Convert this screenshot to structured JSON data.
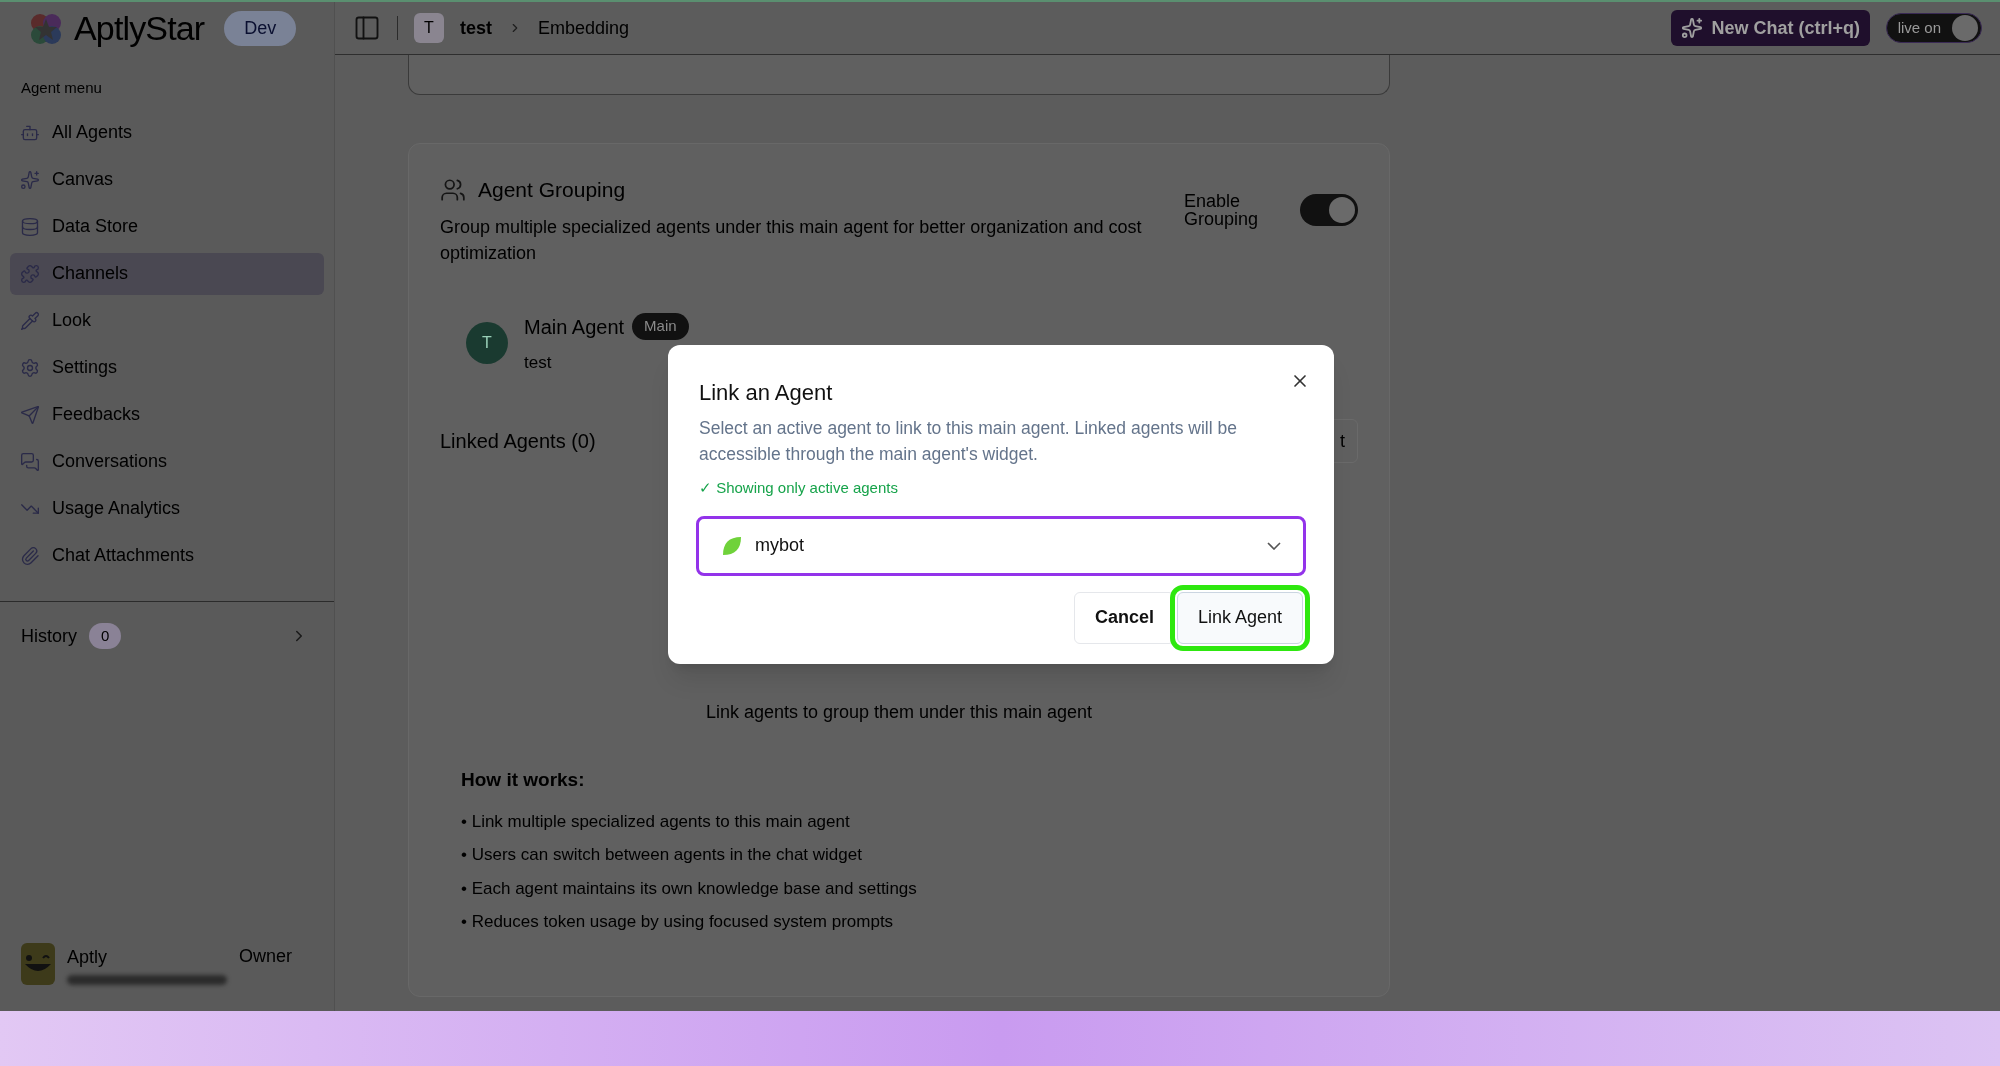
{
  "header": {
    "logo": "AptlyStar",
    "env_badge": "Dev",
    "breadcrumb": {
      "avatar": "T",
      "items": [
        "test",
        "Embedding"
      ]
    },
    "new_chat": "New Chat (ctrl+q)",
    "live_toggle": {
      "label": "live on",
      "on": true
    }
  },
  "sidebar": {
    "heading": "Agent menu",
    "items": [
      {
        "label": "All Agents",
        "selected": false
      },
      {
        "label": "Canvas",
        "selected": false
      },
      {
        "label": "Data Store",
        "selected": false
      },
      {
        "label": "Channels",
        "selected": true
      },
      {
        "label": "Look",
        "selected": false
      },
      {
        "label": "Settings",
        "selected": false
      },
      {
        "label": "Feedbacks",
        "selected": false
      },
      {
        "label": "Conversations",
        "selected": false
      },
      {
        "label": "Usage Analytics",
        "selected": false
      },
      {
        "label": "Chat Attachments",
        "selected": false
      }
    ],
    "history": {
      "label": "History",
      "count": "0"
    },
    "user": {
      "name": "Aptly",
      "role": "Owner"
    }
  },
  "grouping": {
    "title": "Agent Grouping",
    "description": "Group multiple specialized agents under this main agent for better organization and cost optimization",
    "toggle": {
      "label": "Enable Grouping",
      "on": true
    },
    "main_agent": {
      "avatar": "T",
      "name": "Main Agent",
      "badge": "Main",
      "subtitle": "test"
    },
    "linked": {
      "title": "Linked Agents (0)",
      "button": "t",
      "empty_text": "Link agents to group them under this main agent"
    },
    "how_it_works": {
      "title": "How it works:",
      "points": [
        "• Link multiple specialized agents to this main agent",
        "• Users can switch between agents in the chat widget",
        "• Each agent maintains its own knowledge base and settings",
        "• Reduces token usage by using focused system prompts"
      ]
    }
  },
  "dialog": {
    "title": "Link an Agent",
    "description": "Select an active agent to link to this main agent. Linked agents will be accessible through the main agent's widget.",
    "notice": "✓ Showing only active agents",
    "select": {
      "value": "mybot"
    },
    "buttons": [
      {
        "label": "Cancel",
        "kind": "secondary",
        "highlighted": false
      },
      {
        "label": "Link Agent",
        "kind": "primary",
        "highlighted": true
      }
    ]
  }
}
